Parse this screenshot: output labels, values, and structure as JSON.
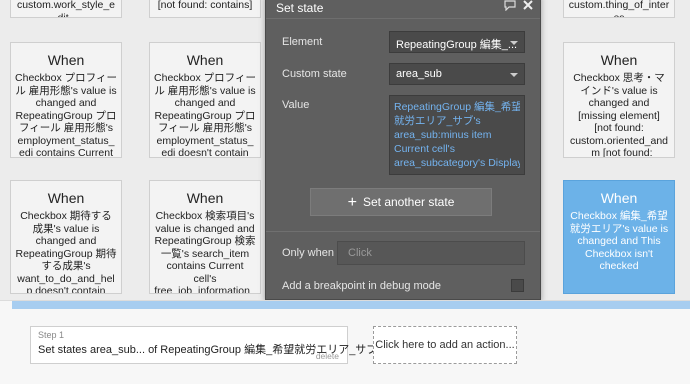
{
  "cards_top": [
    {
      "text": "custom.work_style_edit_"
    },
    {
      "text": "[not found: contains]"
    },
    {
      "text": "custom.thing_of_interes"
    }
  ],
  "cards_row1": [
    {
      "when": "When",
      "desc": "Checkbox プロフィール 雇用形態's value is changed and RepeatingGroup プロフィール 雇用形態's employment_status_edi contains Current cell's"
    },
    {
      "when": "When",
      "desc": "Checkbox プロフィール 雇用形態's value is changed and RepeatingGroup プロフィール 雇用形態's employment_status_edi doesn't contain"
    },
    {
      "when": "When",
      "desc": "Checkbox 思考・マインド's value is changed and [missing element] [not found: custom.oriented_and_m [not found: contains]"
    }
  ],
  "cards_row2": [
    {
      "when": "When",
      "desc": "Checkbox 期待する成果's value is changed and RepeatingGroup 期待する成果's want_to_do_and_help doesn't contain Current cell's"
    },
    {
      "when": "When",
      "desc": "Checkbox 検索項目's value is changed and RepeatingGroup 検索一覧's search_item contains Current cell's free_job_information_ite item"
    },
    {
      "when": "When",
      "desc": "Checkbox 編集_希望就労エリア's value is changed and This Checkbox isn't checked"
    }
  ],
  "panel": {
    "title": "Set state",
    "element_label": "Element",
    "element_value": "RepeatingGroup 編集_...",
    "custom_state_label": "Custom state",
    "custom_state_value": "area_sub",
    "value_label": "Value",
    "value_lines": [
      "RepeatingGroup 編集_希望",
      "就労エリア_サブ's",
      "area_sub:minus item",
      "Current cell's",
      "area_subcategory's Display"
    ],
    "another_label": "Set another state",
    "only_when_label": "Only when",
    "only_when_placeholder": "Click",
    "breakpoint_label": "Add a breakpoint in debug mode"
  },
  "workflow": {
    "step_label": "Step 1",
    "step_text": "Set states area_sub... of RepeatingGroup 編集_希望就労エリア_サブ",
    "delete_label": "delete",
    "add_action_label": "Click here to add an action..."
  },
  "colors": {
    "selected_card": "#6cb2e8",
    "panel_bg": "#5f5f5f",
    "link_blue": "#74b3ef",
    "bar_accent": "#a7cdf0"
  }
}
